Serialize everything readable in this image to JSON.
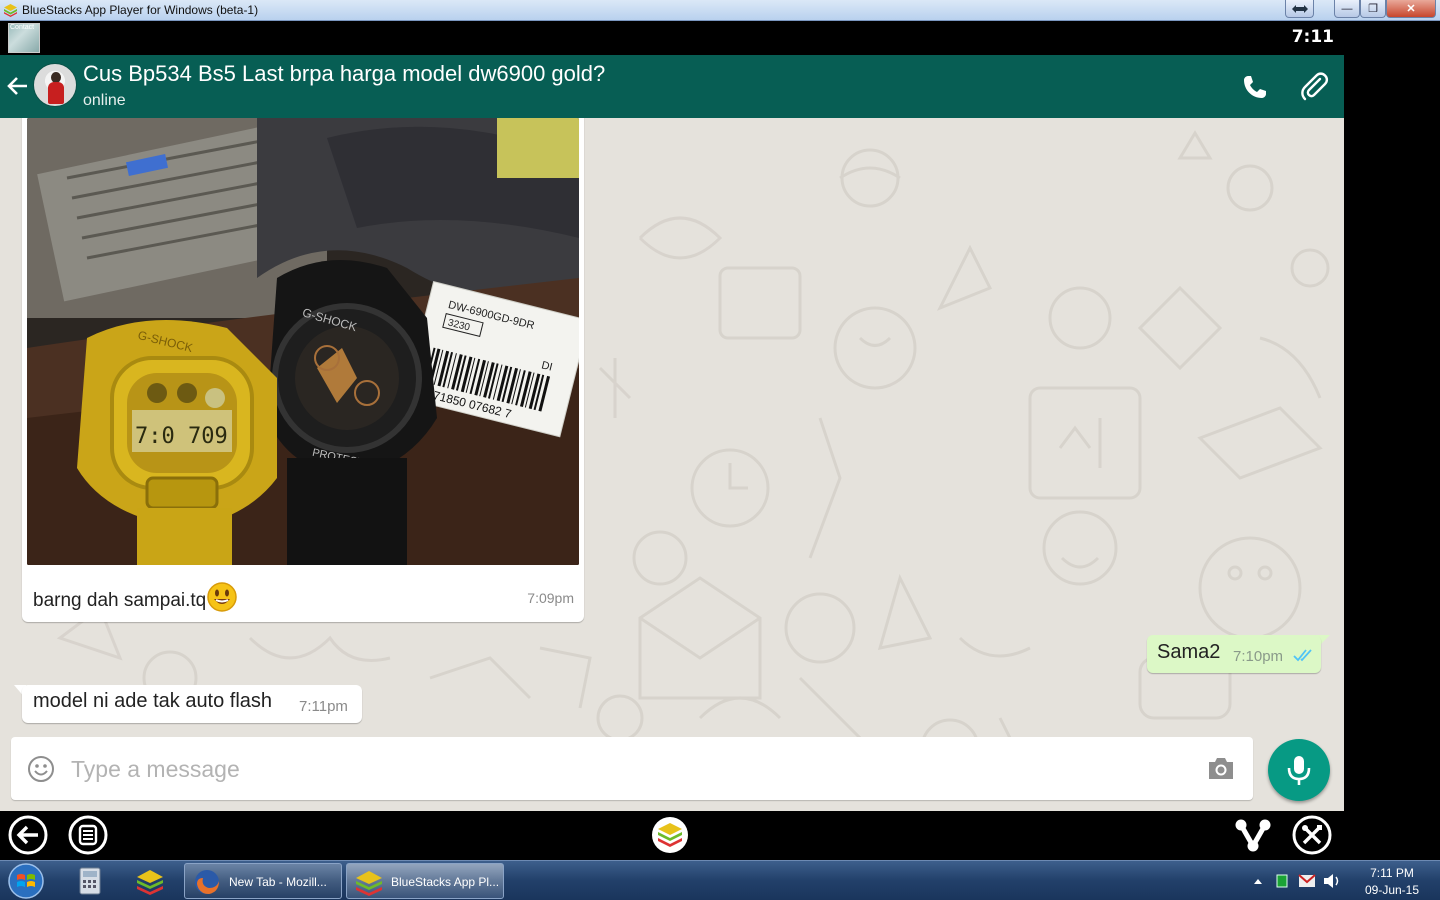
{
  "window": {
    "title": "BlueStacks App Player for Windows (beta-1)",
    "minimize_label": "—",
    "restore_label": "❐",
    "close_label": "✕"
  },
  "status_bar": {
    "time": "7:11",
    "thumbnail_text": "Contact"
  },
  "chat_header": {
    "contact_name": "Cus Bp534 Bs5 Last brpa harga model dw6900 gold?",
    "contact_status": "online"
  },
  "messages": [
    {
      "direction": "incoming",
      "type": "image",
      "caption": "barng dah sampai.tq",
      "emoji": "smiley",
      "time": "7:09pm"
    },
    {
      "direction": "outgoing",
      "type": "text",
      "text": "Sama2",
      "time": "7:10pm",
      "status": "read"
    },
    {
      "direction": "incoming",
      "type": "text",
      "text": "model ni ade tak auto flash",
      "time": "7:11pm"
    }
  ],
  "photo": {
    "tag_line1": "DW-6900GD-9DR",
    "tag_box": "3230",
    "tag_code": "DI",
    "tag_barcode": "4971850 07682 7",
    "watch1_brand": "G-SHOCK",
    "watch1_time": "7:0 709",
    "watch2_brand": "G-SHOCK",
    "watch2_text": "PROTECTION"
  },
  "composer": {
    "placeholder": "Type a message",
    "value": ""
  },
  "taskbar": {
    "tasks": [
      {
        "label": "New Tab - Mozill..."
      },
      {
        "label": "BlueStacks App Pl..."
      }
    ],
    "clock_time": "7:11 PM",
    "clock_date": "09-Jun-15"
  },
  "colors": {
    "header": "#075e54",
    "outgoing_bubble": "#dcf8c6",
    "mic_button": "#079a84",
    "read_ticks": "#4fc3f7"
  }
}
